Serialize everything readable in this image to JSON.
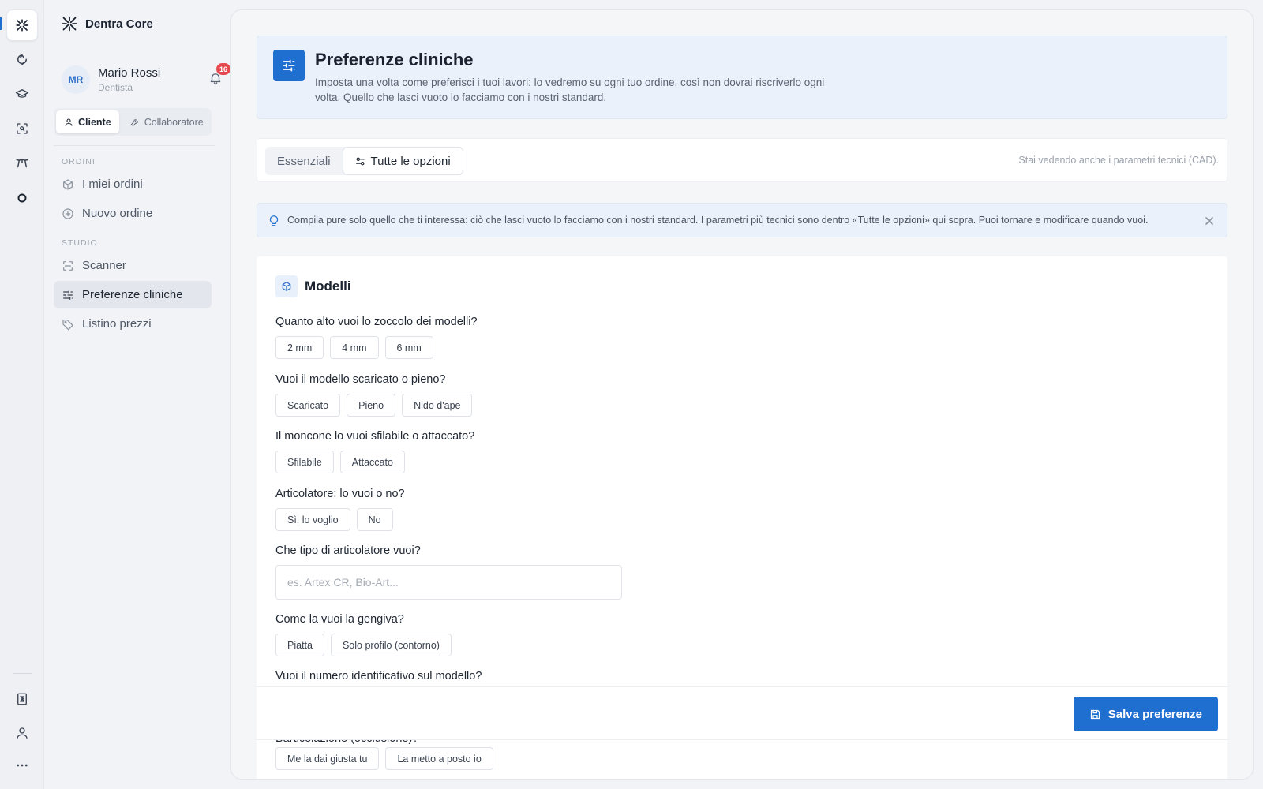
{
  "app": {
    "brand": "Dentra Core"
  },
  "user": {
    "initials": "MR",
    "name": "Mario Rossi",
    "role": "Dentista",
    "notifications": "16"
  },
  "role_switch": {
    "client": "Cliente",
    "collaborator": "Collaboratore"
  },
  "sidebar": {
    "section_orders": "ORDINI",
    "section_studio": "STUDIO",
    "items": [
      {
        "label": "I miei ordini",
        "icon": "box-icon"
      },
      {
        "label": "Nuovo ordine",
        "icon": "plus-circle-icon"
      },
      {
        "label": "Scanner",
        "icon": "scan-icon"
      },
      {
        "label": "Preferenze cliniche",
        "icon": "sliders-icon"
      },
      {
        "label": "Listino prezzi",
        "icon": "tag-icon"
      }
    ]
  },
  "rail": {
    "top": [
      "logo-icon",
      "route-icon",
      "graduation-cap-icon",
      "scan-search-icon",
      "tooth-icon",
      "ring-icon"
    ],
    "bottom": [
      "invoice-icon",
      "user-icon",
      "more-icon"
    ]
  },
  "header": {
    "title": "Preferenze cliniche",
    "description": "Imposta una volta come preferisci i tuoi lavori: lo vedremo su ogni tuo ordine, così non dovrai riscriverlo ogni volta. Quello che lasci vuoto lo facciamo con i nostri standard."
  },
  "tabs": {
    "essentials": "Essenziali",
    "all_options": "Tutte le opzioni",
    "note": "Stai vedendo anche i parametri tecnici (CAD)."
  },
  "info": {
    "text": "Compila pure solo quello che ti interessa: ciò che lasci vuoto lo facciamo con i nostri standard. I parametri più tecnici sono dentro «Tutte le opzioni» qui sopra. Puoi tornare e modificare quando vuoi."
  },
  "section": {
    "title": "Modelli",
    "questions": [
      {
        "label": "Quanto alto vuoi lo zoccolo dei modelli?",
        "options": [
          "2 mm",
          "4 mm",
          "6 mm"
        ]
      },
      {
        "label": "Vuoi il modello scaricato o pieno?",
        "options": [
          "Scaricato",
          "Pieno",
          "Nido d'ape"
        ]
      },
      {
        "label": "Il moncone lo vuoi sfilabile o attaccato?",
        "options": [
          "Sfilabile",
          "Attaccato"
        ]
      },
      {
        "label": "Articolatore: lo vuoi o no?",
        "options": [
          "Sì, lo voglio",
          "No"
        ]
      },
      {
        "label": "Che tipo di articolatore vuoi?",
        "placeholder": "es. Artex CR, Bio-Art..."
      },
      {
        "label": "Come la vuoi la gengiva?",
        "options": [
          "Piatta",
          "Solo profilo (contorno)"
        ]
      },
      {
        "label": "Vuoi il numero identificativo sul modello?"
      },
      {
        "label": "Barticolazione (occlusione)?",
        "options": [
          "Me la dai giusta tu",
          "La metto a posto io"
        ]
      }
    ]
  },
  "save": {
    "label": "Salva preferenze"
  }
}
